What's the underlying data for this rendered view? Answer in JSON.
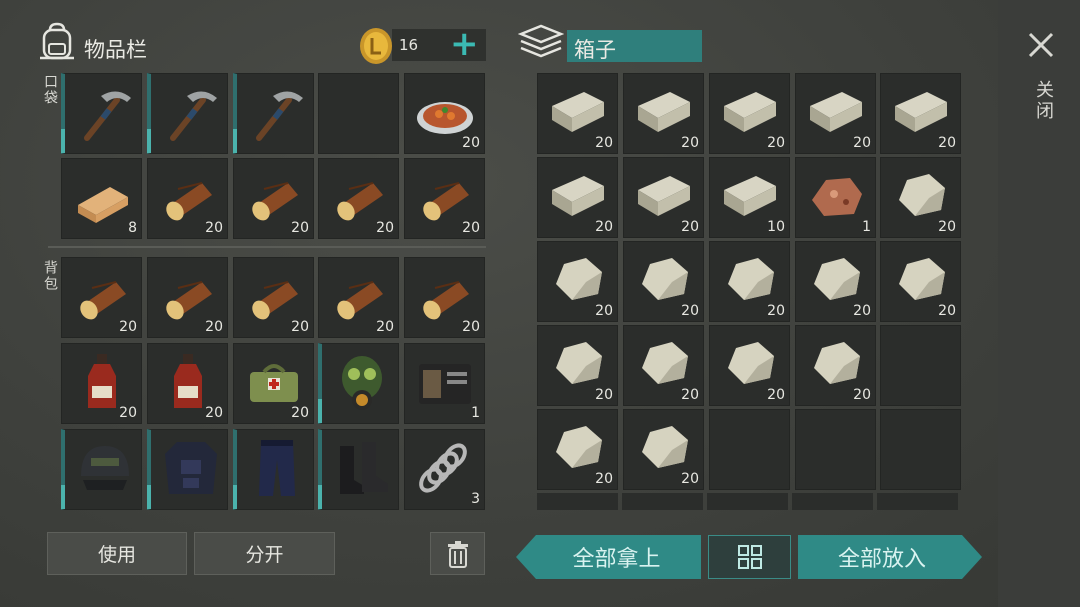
{
  "inventory": {
    "title": "物品栏",
    "coins": "16",
    "add_symbol": "+",
    "pocket_label": "口袋",
    "backpack_label": "背包",
    "pocket": [
      {
        "icon": "pickaxe-icon",
        "count": ""
      },
      {
        "icon": "pickaxe-icon",
        "count": ""
      },
      {
        "icon": "pickaxe-icon",
        "count": ""
      },
      {
        "icon": "empty",
        "count": ""
      },
      {
        "icon": "food-plate-icon",
        "count": "20"
      },
      {
        "icon": "plank-icon",
        "count": "8"
      },
      {
        "icon": "log-icon",
        "count": "20"
      },
      {
        "icon": "log-icon",
        "count": "20"
      },
      {
        "icon": "log-icon",
        "count": "20"
      },
      {
        "icon": "log-icon",
        "count": "20"
      }
    ],
    "backpack": [
      {
        "icon": "log-icon",
        "count": "20"
      },
      {
        "icon": "log-icon",
        "count": "20"
      },
      {
        "icon": "log-icon",
        "count": "20"
      },
      {
        "icon": "log-icon",
        "count": "20"
      },
      {
        "icon": "log-icon",
        "count": "20"
      },
      {
        "icon": "bottle-icon",
        "count": "20"
      },
      {
        "icon": "bottle-icon",
        "count": "20"
      },
      {
        "icon": "medkit-bag-icon",
        "count": "20"
      },
      {
        "icon": "gas-mask-icon",
        "count": ""
      },
      {
        "icon": "wallet-icon",
        "count": "1"
      },
      {
        "icon": "helmet-icon",
        "count": ""
      },
      {
        "icon": "armor-vest-icon",
        "count": ""
      },
      {
        "icon": "pants-icon",
        "count": ""
      },
      {
        "icon": "boots-icon",
        "count": ""
      },
      {
        "icon": "spring-icon",
        "count": "3"
      }
    ],
    "use_label": "使用",
    "split_label": "分开"
  },
  "box": {
    "title": "箱子",
    "items": [
      {
        "icon": "stone-brick-icon",
        "count": "20"
      },
      {
        "icon": "stone-brick-icon",
        "count": "20"
      },
      {
        "icon": "stone-brick-icon",
        "count": "20"
      },
      {
        "icon": "stone-brick-icon",
        "count": "20"
      },
      {
        "icon": "stone-brick-icon",
        "count": "20"
      },
      {
        "icon": "stone-brick-icon",
        "count": "20"
      },
      {
        "icon": "stone-brick-icon",
        "count": "20"
      },
      {
        "icon": "stone-brick-icon",
        "count": "10"
      },
      {
        "icon": "iron-ore-icon",
        "count": "1"
      },
      {
        "icon": "stone-icon",
        "count": "20"
      },
      {
        "icon": "stone-icon",
        "count": "20"
      },
      {
        "icon": "stone-icon",
        "count": "20"
      },
      {
        "icon": "stone-icon",
        "count": "20"
      },
      {
        "icon": "stone-icon",
        "count": "20"
      },
      {
        "icon": "stone-icon",
        "count": "20"
      },
      {
        "icon": "stone-icon",
        "count": "20"
      },
      {
        "icon": "stone-icon",
        "count": "20"
      },
      {
        "icon": "stone-icon",
        "count": "20"
      },
      {
        "icon": "stone-icon",
        "count": "20"
      },
      {
        "icon": "empty",
        "count": ""
      },
      {
        "icon": "stone-icon",
        "count": "20"
      },
      {
        "icon": "stone-icon",
        "count": "20"
      },
      {
        "icon": "empty",
        "count": ""
      },
      {
        "icon": "empty",
        "count": ""
      },
      {
        "icon": "empty",
        "count": ""
      }
    ],
    "take_all_label": "全部拿上",
    "put_all_label": "全部放入"
  },
  "close_label": "关闭",
  "colors": {
    "teal": "#2f8a86",
    "teal_dark": "#2f6f6e",
    "slot": "#2b2d2b"
  }
}
